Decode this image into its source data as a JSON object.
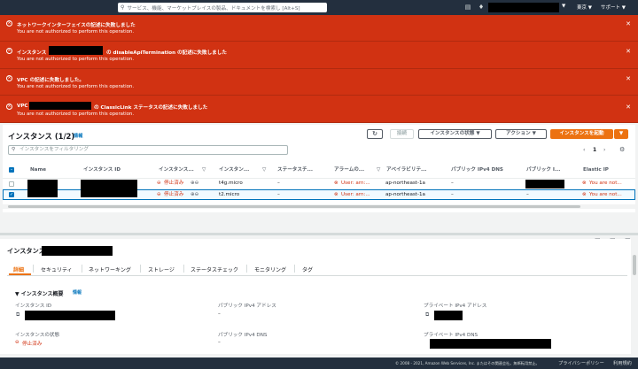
{
  "topbar": {
    "search_placeholder": "サービス、機能、マーケットプレイスの製品、ドキュメントを検索し  [Alt+S]",
    "region": "東京 ▼",
    "support": "サポート ▼",
    "account_caret": "▼"
  },
  "banners": [
    {
      "title": "ネットワークインターフェイスの記述に失敗しました",
      "msg": "You are not authorized to perform this operation."
    },
    {
      "title_pre": "インスタンス",
      "title_post": "の disableApiTermination の記述に失敗しました",
      "msg": "You are not authorized to perform this operation."
    },
    {
      "title": "VPC の記述に失敗しました。",
      "msg": "You are not authorized to perform this operation."
    },
    {
      "title_pre": "VPC",
      "title_post": "の ClassicLink ステータスの記述に失敗しました",
      "msg": "You are not authorized to perform this operation."
    }
  ],
  "instances": {
    "title": "インスタンス (1/2)",
    "info": "情報",
    "refresh_icon": "refresh-icon",
    "connect": "接続",
    "state_btn": "インスタンスの状態 ▼",
    "action_btn": "アクション ▼",
    "launch_btn": "インスタンスを起動",
    "launch_caret": "▼",
    "filter_placeholder": "インスタンスをフィルタリング",
    "page": "1",
    "columns": [
      "Name",
      "インスタンス ID",
      "インスタンス...",
      "インスタン...",
      "ステータスチ...",
      "アラームの...",
      "アベイラビリテ...",
      "パブリック IPv4 DNS",
      "パブリック I...",
      "Elastic IP"
    ],
    "rows": [
      {
        "state": "停止済み",
        "type": "t4g.micro",
        "status": "–",
        "alarm": "User: arn:...",
        "az": "ap-northeast-1a",
        "dns": "–",
        "eip": "You are not..."
      },
      {
        "state": "停止済み",
        "type": "t2.micro",
        "status": "–",
        "alarm": "User: arn:...",
        "az": "ap-northeast-1a",
        "dns": "–",
        "pubip": "–",
        "eip": "You are not..."
      }
    ]
  },
  "detail": {
    "title": "インスタンス:",
    "tabs": [
      "詳細",
      "セキュリティ",
      "ネットワーキング",
      "ストレージ",
      "ステータスチェック",
      "モニタリング",
      "タグ"
    ],
    "section": "▼ インスタンス概要",
    "section_info": "情報",
    "labels": {
      "id": "インスタンス ID",
      "pub_ip": "パブリック IPv4 アドレス",
      "priv_ip": "プライベート IPv4 アドレス",
      "state": "インスタンスの状態",
      "pub_dns": "パブリック IPv4 DNS",
      "priv_dns": "プライベート IPv4 DNS"
    },
    "values": {
      "pub_ip": "–",
      "state": "停止済み",
      "pub_dns": "–"
    }
  },
  "footer": {
    "copyright": "© 2008 - 2021, Amazon Web Services, Inc. またはその関連会社。無断転用禁止。",
    "privacy": "プライバシーポリシー",
    "terms": "利用規約"
  }
}
